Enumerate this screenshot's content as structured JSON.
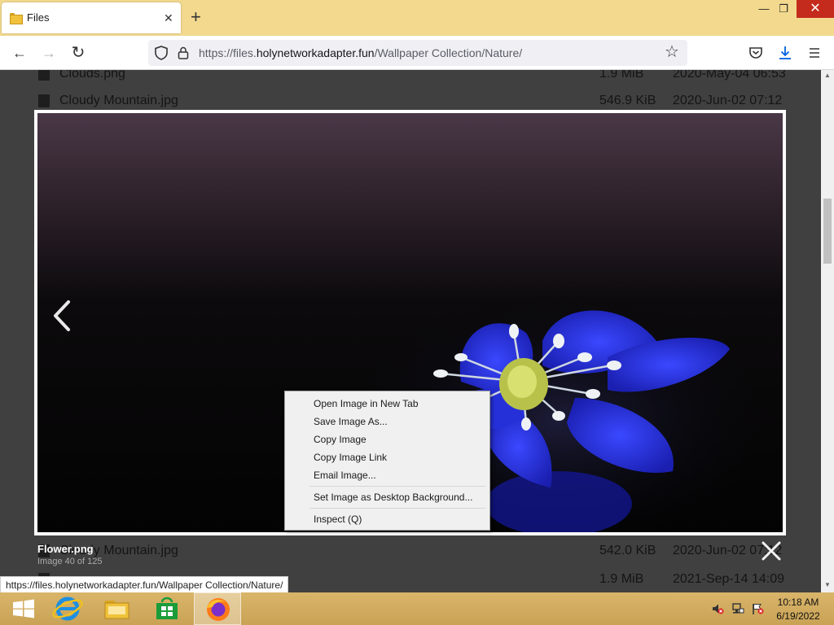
{
  "browser": {
    "tab_title": "Files",
    "url_prefix": "https://files.",
    "url_host": "holynetworkadapter.fun",
    "url_path": "/Wallpaper Collection/Nature/"
  },
  "file_list": {
    "rows": [
      {
        "name": "Clouds.png",
        "size": "1.9 MiB",
        "date": "2020-May-04 06:53"
      },
      {
        "name": "Cloudy Mountain.jpg",
        "size": "546.9 KiB",
        "date": "2020-Jun-02 07:12"
      },
      {
        "name": "Cloudy Mountain.jpg",
        "size": "542.0 KiB",
        "date": "2020-Jun-02 07:12"
      },
      {
        "name": "",
        "size": "1.9 MiB",
        "date": "2021-Sep-14 14:09"
      }
    ]
  },
  "lightbox": {
    "caption": "Flower.png",
    "counter": "Image 40 of 125"
  },
  "context_menu": {
    "items": [
      {
        "label": "Open Image in New Tab"
      },
      {
        "label": "Save Image As..."
      },
      {
        "label": "Copy Image"
      },
      {
        "label": "Copy Image Link"
      },
      {
        "label": "Email Image..."
      },
      {
        "label": "Set Image as Desktop Background..."
      },
      {
        "label": "Inspect (Q)"
      }
    ]
  },
  "status_bar": {
    "url": "https://files.holynetworkadapter.fun/Wallpaper Collection/Nature/"
  },
  "taskbar": {
    "apps": [
      "start-icon",
      "internet-explorer-icon",
      "file-explorer-icon",
      "store-icon",
      "firefox-icon"
    ],
    "time": "10:18 AM",
    "date": "6/19/2022"
  },
  "colors": {
    "tab_strip": "#f2d98e",
    "taskbar": "#d9b56a",
    "flower_blue": "#2a35e0",
    "close_button": "#c42b1c"
  }
}
